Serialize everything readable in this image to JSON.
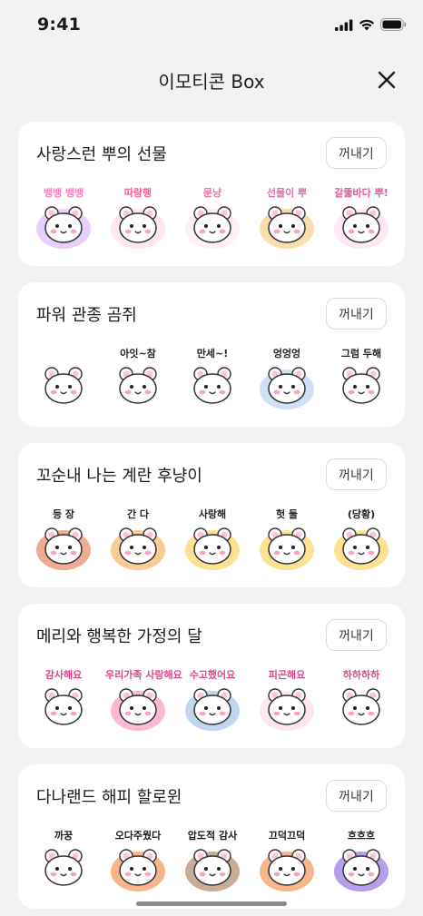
{
  "status": {
    "time": "9:41"
  },
  "header": {
    "title": "이모티콘 Box",
    "close_icon": "close-icon"
  },
  "packs": [
    {
      "title": "사랑스런 뿌의 선물",
      "button": "꺼내기",
      "stickers": [
        {
          "caption": "뱅뱅 뱅뱅",
          "color": "#ff7fbf",
          "bg": "#d6a7ff"
        },
        {
          "caption": "따랑행",
          "color": "#ff5c9a",
          "bg": "#ffd1e6"
        },
        {
          "caption": "문냥",
          "color": "#ff6fa8",
          "bg": "#ffe1ef"
        },
        {
          "caption": "선물이 뿌",
          "color": "#e26ab0",
          "bg": "#f5c16c"
        },
        {
          "caption": "갈뚫바다 뿌!",
          "color": "#e75aa3",
          "bg": "#ffd6ee"
        }
      ]
    },
    {
      "title": "파워 관종 곰쥐",
      "button": "꺼내기",
      "stickers": [
        {
          "caption": "",
          "color": "#222222",
          "bg": "#ffffff"
        },
        {
          "caption": "아잇~참",
          "color": "#222222",
          "bg": "#ffffff"
        },
        {
          "caption": "만세~!",
          "color": "#222222",
          "bg": "#ffffff"
        },
        {
          "caption": "엉엉엉",
          "color": "#222222",
          "bg": "#a9c7ec"
        },
        {
          "caption": "그럼 두해",
          "color": "#222222",
          "bg": "#ffffff"
        }
      ]
    },
    {
      "title": "꼬순내 나는 계란 후냥이",
      "button": "꺼내기",
      "stickers": [
        {
          "caption": "등 장",
          "color": "#222222",
          "bg": "#e4673a"
        },
        {
          "caption": "간 다",
          "color": "#222222",
          "bg": "#f3a23c"
        },
        {
          "caption": "사랑해",
          "color": "#222222",
          "bg": "#ffc93a"
        },
        {
          "caption": "헛 둘",
          "color": "#222222",
          "bg": "#ffc93a"
        },
        {
          "caption": "(당황)",
          "color": "#222222",
          "bg": "#ffc93a"
        }
      ]
    },
    {
      "title": "메리와 행복한 가정의 달",
      "button": "꺼내기",
      "stickers": [
        {
          "caption": "감사해요",
          "color": "#e0458d",
          "bg": "#ffffff"
        },
        {
          "caption": "우리가족 사랑해요",
          "color": "#e0458d",
          "bg": "#ff7fb5"
        },
        {
          "caption": "수고했어요",
          "color": "#e0458d",
          "bg": "#8eb4de"
        },
        {
          "caption": "피곤해요",
          "color": "#e0458d",
          "bg": "#ffd1e2"
        },
        {
          "caption": "하하하하",
          "color": "#e0458d",
          "bg": "#ffffff"
        }
      ]
    },
    {
      "title": "다나랜드 해피 할로윈",
      "button": "꺼내기",
      "stickers": [
        {
          "caption": "까꿍",
          "color": "#1b1b1b",
          "bg": "#ffffff"
        },
        {
          "caption": "오다주웠다",
          "color": "#1b1b1b",
          "bg": "#f27a2a"
        },
        {
          "caption": "압도적 감사",
          "color": "#1b1b1b",
          "bg": "#9a6a3f"
        },
        {
          "caption": "끄덕끄덕",
          "color": "#1b1b1b",
          "bg": "#f27a2a"
        },
        {
          "caption": "흐흐흐",
          "color": "#1b1b1b",
          "bg": "#7b4fd8"
        }
      ]
    }
  ]
}
